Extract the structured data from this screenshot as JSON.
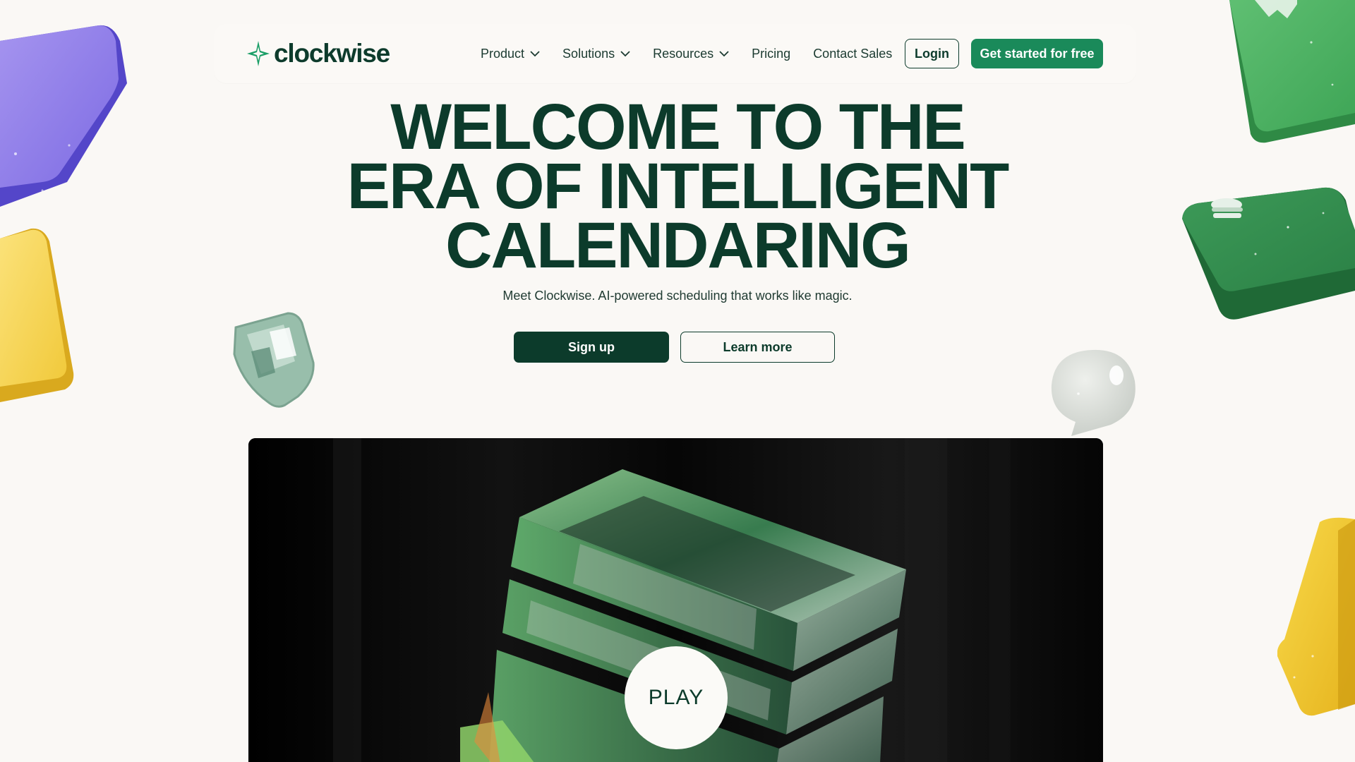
{
  "brand": {
    "name": "clockwise",
    "logo_icon": "clockwise-diamond-logo-icon",
    "primary_color": "#0c3b2b",
    "accent_color": "#1a8a5a",
    "background_color": "#faf8f5"
  },
  "nav": {
    "items": [
      {
        "label": "Product",
        "has_dropdown": true
      },
      {
        "label": "Solutions",
        "has_dropdown": true
      },
      {
        "label": "Resources",
        "has_dropdown": true
      },
      {
        "label": "Pricing",
        "has_dropdown": false
      },
      {
        "label": "Contact Sales",
        "has_dropdown": false
      }
    ],
    "login_label": "Login",
    "cta_label": "Get started for free"
  },
  "hero": {
    "title_lines": [
      "WELCOME TO THE",
      "ERA OF INTELLIGENT",
      "CALENDARING"
    ],
    "subtitle": "Meet Clockwise. AI-powered scheduling that works like magic.",
    "signup_label": "Sign up",
    "learn_more_label": "Learn more"
  },
  "video": {
    "play_label": "PLAY"
  },
  "decorations": {
    "icons": [
      "purple-block-icon",
      "yellow-block-icon",
      "shield-icon",
      "green-key-icon",
      "green-burger-key-icon",
      "speech-bubble-icon",
      "yellow-cube-icon"
    ]
  }
}
